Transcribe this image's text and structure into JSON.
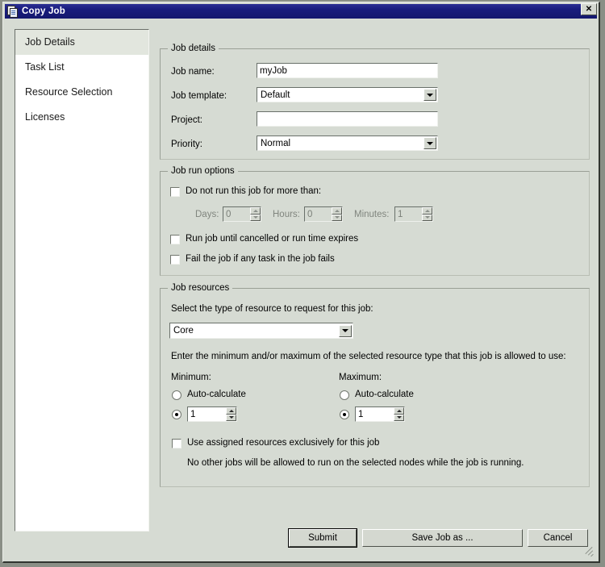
{
  "window": {
    "title": "Copy Job",
    "icon": "copy-document-icon",
    "close_label": "✕",
    "titlebar_color": "#191d7e",
    "background_color": "#d6dbd3"
  },
  "sidebar": {
    "items": [
      {
        "label": "Job Details",
        "selected": true
      },
      {
        "label": "Task List",
        "selected": false
      },
      {
        "label": "Resource Selection",
        "selected": false
      },
      {
        "label": "Licenses",
        "selected": false
      }
    ]
  },
  "job_details": {
    "legend": "Job details",
    "job_name_label": "Job name:",
    "job_name_value": "myJob",
    "job_template_label": "Job template:",
    "job_template_value": "Default",
    "project_label": "Project:",
    "project_value": "",
    "project_placeholder": "",
    "priority_label": "Priority:",
    "priority_value": "Normal"
  },
  "job_run_options": {
    "legend": "Job run options",
    "do_not_run_label": "Do not run this job for more than:",
    "do_not_run_checked": false,
    "days_label": "Days:",
    "days_value": "0",
    "hours_label": "Hours:",
    "hours_value": "0",
    "minutes_label": "Minutes:",
    "minutes_value": "1",
    "run_until_cancelled_label": "Run job until cancelled or run time expires",
    "run_until_cancelled_checked": false,
    "fail_job_label": "Fail the job if any task in the job fails",
    "fail_job_checked": false
  },
  "job_resources": {
    "legend": "Job resources",
    "select_type_label": "Select the type of resource to request for this job:",
    "resource_type_value": "Core",
    "enter_min_max_label": "Enter the minimum and/or maximum of the selected resource type that this job is allowed to use:",
    "minimum_label": "Minimum:",
    "minimum_auto_label": "Auto-calculate",
    "minimum_auto_selected": false,
    "minimum_value": "1",
    "minimum_value_selected": true,
    "maximum_label": "Maximum:",
    "maximum_auto_label": "Auto-calculate",
    "maximum_auto_selected": false,
    "maximum_value": "1",
    "maximum_value_selected": true,
    "exclusive_label": "Use assigned resources exclusively for this job",
    "exclusive_checked": false,
    "exclusive_note": "No other jobs will be allowed to run on the selected nodes while the job is running."
  },
  "footer": {
    "submit_label": "Submit",
    "save_job_as_label": "Save Job as ...",
    "cancel_label": "Cancel"
  }
}
